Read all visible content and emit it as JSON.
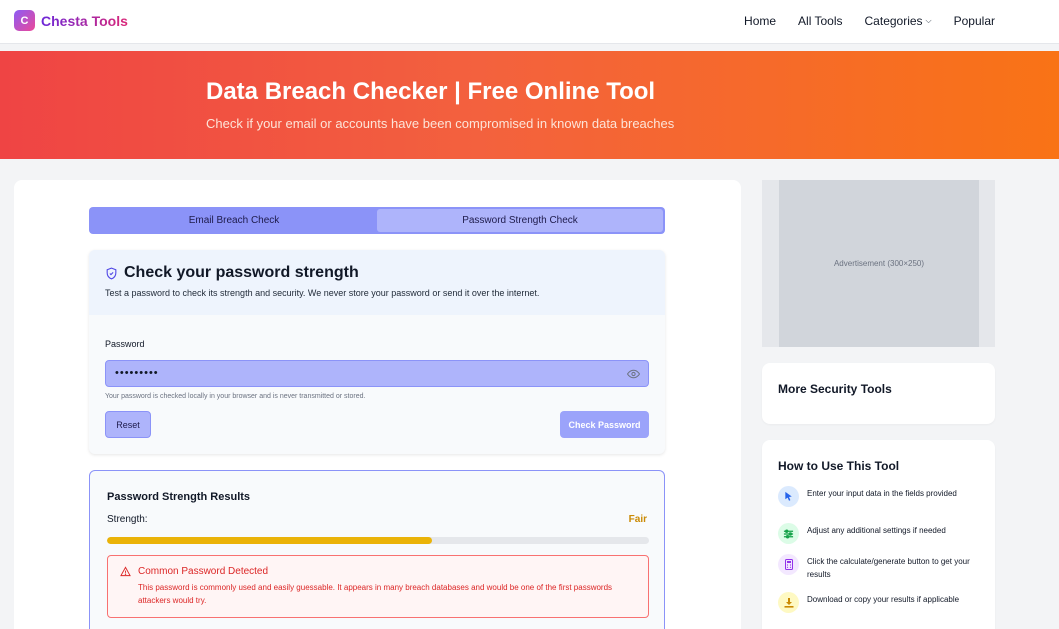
{
  "header": {
    "logo_letter": "C",
    "brand": "Chesta Tools",
    "nav": [
      "Home",
      "All Tools",
      "Categories",
      "Popular"
    ]
  },
  "hero": {
    "title": "Data Breach Checker | Free Online Tool",
    "subtitle": "Check if your email or accounts have been compromised in known data breaches"
  },
  "tabs": [
    {
      "label": "Email Breach Check",
      "active": false
    },
    {
      "label": "Password Strength Check",
      "active": true
    }
  ],
  "password_card": {
    "title": "Check your password strength",
    "description": "Test a password to check its strength and security. We never store your password or send it over the internet.",
    "field_label": "Password",
    "field_value": "•••••••••",
    "hint": "Your password is checked locally in your browser and is never transmitted or stored.",
    "reset_label": "Reset",
    "check_label": "Check Password"
  },
  "results": {
    "title": "Password Strength Results",
    "strength_label": "Strength:",
    "strength_value": "Fair",
    "strength_fraction": 0.6,
    "alert_title": "Common Password Detected",
    "alert_text": "This password is commonly used and easily guessable. It appears in many breach databases and would be one of the first passwords attackers would try."
  },
  "sidebar": {
    "ad_text": "Advertisement (300×250)",
    "more_tools_title": "More Security Tools",
    "howto_title": "How to Use This Tool",
    "steps": [
      {
        "icon": "cursor-icon",
        "text": "Enter your input data in the fields provided"
      },
      {
        "icon": "sliders-icon",
        "text": "Adjust any additional settings if needed"
      },
      {
        "icon": "calculator-icon",
        "text": "Click the calculate/generate button to get your results"
      },
      {
        "icon": "download-icon",
        "text": "Download or copy your results if applicable"
      }
    ]
  },
  "colors": {
    "hero_start": "#ef4444",
    "hero_end": "#f97316",
    "accent": "#8b93f8",
    "strength_fair": "#eab308",
    "alert_red": "#dc2626"
  }
}
